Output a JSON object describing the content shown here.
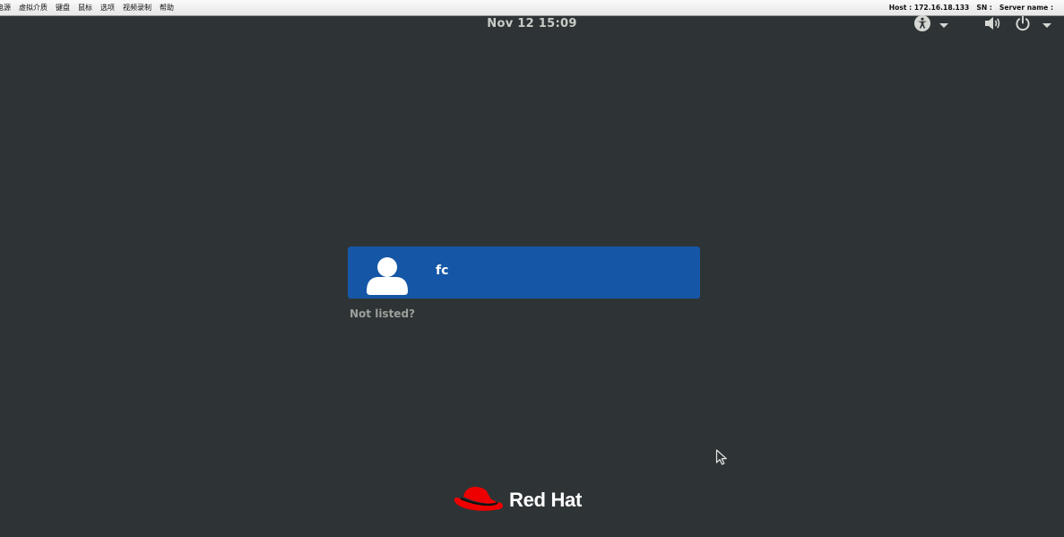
{
  "kvm_toolbar": {
    "menu": [
      "电源",
      "虚拟介质",
      "键盘",
      "鼠标",
      "选项",
      "视频录制",
      "帮助"
    ],
    "host": "Host : 172.16.18.133",
    "sn": "SN :",
    "server_name": "Server name :"
  },
  "top_bar": {
    "clock": "Nov 12  15:09",
    "tray_icons": [
      "accessibility-icon",
      "volume-icon",
      "power-icon"
    ]
  },
  "login": {
    "users": [
      {
        "name": "fc"
      }
    ],
    "not_listed": "Not listed?"
  },
  "branding": {
    "logo_text": "Red Hat",
    "logo_color": "#ee0000"
  },
  "colors": {
    "background": "#2e3436",
    "user_card": "#1557a6"
  }
}
